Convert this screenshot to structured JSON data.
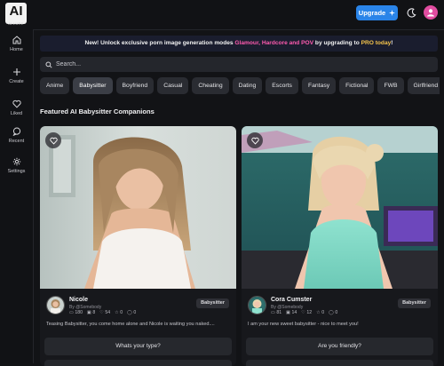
{
  "header": {
    "logo_text": "AI",
    "logo_sub": "ALLURE",
    "upgrade_label": "Upgrade",
    "theme_icon": "moon-icon",
    "avatar_icon": "user-icon",
    "accent": "#2a84e8",
    "avatar_color": "#e04ca0"
  },
  "sidebar": {
    "items": [
      {
        "label": "Home",
        "icon": "home-icon"
      },
      {
        "label": "Create",
        "icon": "plus-icon"
      },
      {
        "label": "Liked",
        "icon": "heart-icon"
      },
      {
        "label": "Recent",
        "icon": "chat-icon"
      },
      {
        "label": "Settings",
        "icon": "gear-icon"
      }
    ]
  },
  "banner": {
    "text_before": "New! Unlock exclusive porn image generation modes ",
    "modes": "Glamour, Hardcore and POV",
    "text_middle": " by upgrading to ",
    "pro": "PRO today",
    "text_after": "!"
  },
  "search": {
    "placeholder": "Search..."
  },
  "categories": [
    "Anime",
    "Babysitter",
    "Boyfriend",
    "Casual",
    "Cheating",
    "Dating",
    "Escorts",
    "Fantasy",
    "Fictional",
    "FWB",
    "Girlfriend"
  ],
  "active_category": "Babysitter",
  "section_title": "Featured AI Babysitter Companions",
  "cards": [
    {
      "name": "Nicole",
      "by": "By @Somebody",
      "stats": {
        "messages": "180",
        "images": "8",
        "likes": "54",
        "stars": "0",
        "comments": "0"
      },
      "badge": "Babysitter",
      "description": "Teasing Babysitter, you come home alone and Nicole is waiting you naked....",
      "prompt": "Whats your type?"
    },
    {
      "name": "Cora Cumster",
      "by": "By @Somebody",
      "stats": {
        "messages": "81",
        "images": "14",
        "likes": "12",
        "stars": "0",
        "comments": "0"
      },
      "badge": "Babysitter",
      "description": "I am your new sweet babysitter - nice to meet you!",
      "prompt": "Are you friendly?"
    }
  ]
}
